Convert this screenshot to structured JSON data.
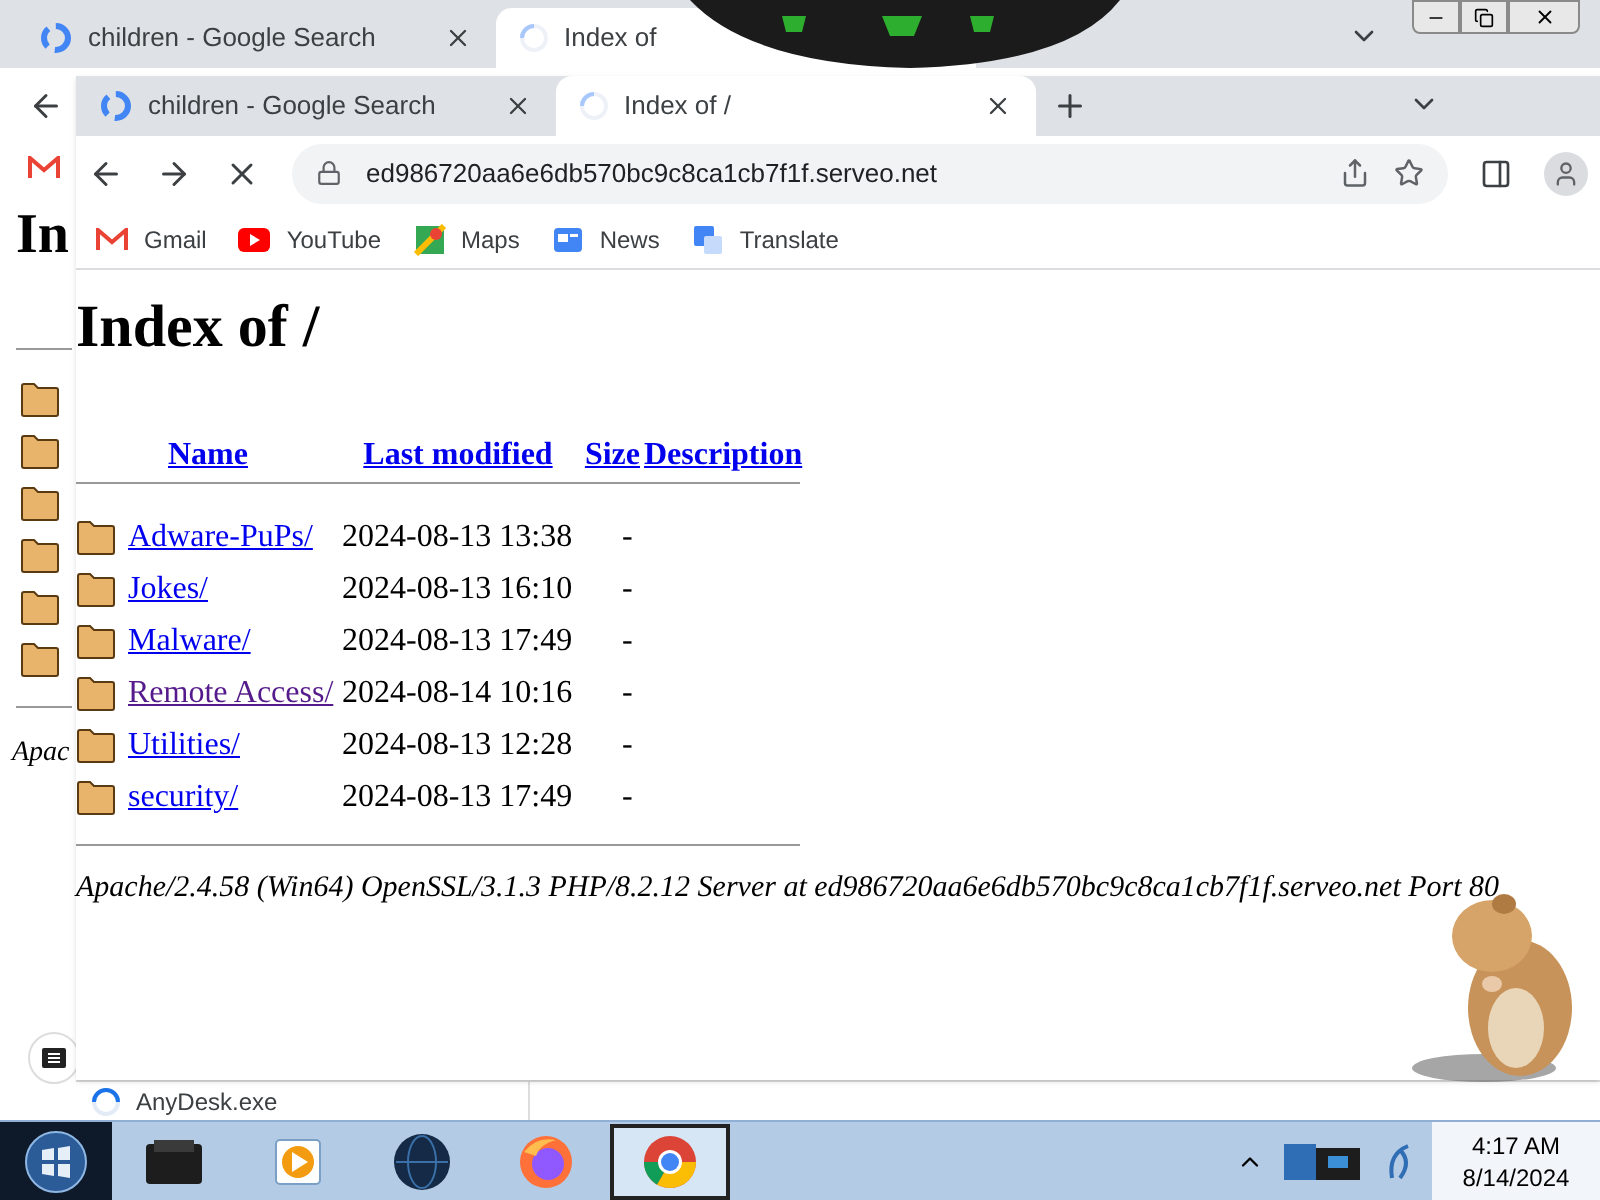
{
  "outer_browser": {
    "tabs": [
      {
        "title": "children - Google Search",
        "kind": "google",
        "selected": false
      },
      {
        "title": "Index of",
        "kind": "loading",
        "selected": true
      }
    ],
    "page_heading": "In",
    "footer": "Apac",
    "download": "AnyDesk.exe"
  },
  "inner_browser": {
    "tabs": [
      {
        "title": "children - Google Search",
        "kind": "google",
        "selected": false
      },
      {
        "title": "Index of /",
        "kind": "loading",
        "selected": true
      }
    ],
    "url": "ed986720aa6e6db570bc9c8ca1cb7f1f.serveo.net",
    "bookmarks": [
      {
        "label": "Gmail",
        "kind": "gmail"
      },
      {
        "label": "YouTube",
        "kind": "youtube"
      },
      {
        "label": "Maps",
        "kind": "maps"
      },
      {
        "label": "News",
        "kind": "news"
      },
      {
        "label": "Translate",
        "kind": "translate"
      }
    ]
  },
  "page": {
    "heading": "Index of /",
    "columns": [
      "Name",
      "Last modified",
      "Size",
      "Description"
    ],
    "rows": [
      {
        "name": "Adware-PuPs/",
        "modified": "2024-08-13 13:38",
        "size": "-",
        "visited": false
      },
      {
        "name": "Jokes/",
        "modified": "2024-08-13 16:10",
        "size": "-",
        "visited": false
      },
      {
        "name": "Malware/",
        "modified": "2024-08-13 17:49",
        "size": "-",
        "visited": false
      },
      {
        "name": "Remote Access/",
        "modified": "2024-08-14 10:16",
        "size": "-",
        "visited": true
      },
      {
        "name": "Utilities/",
        "modified": "2024-08-13 12:28",
        "size": "-",
        "visited": false
      },
      {
        "name": "security/",
        "modified": "2024-08-13 17:49",
        "size": "-",
        "visited": false
      }
    ],
    "address": "Apache/2.4.58 (Win64) OpenSSL/3.1.3 PHP/8.2.12 Server at ed986720aa6e6db570bc9c8ca1cb7f1f.serveo.net Port 80"
  },
  "taskbar": {
    "apps": [
      {
        "kind": "device",
        "selected": false
      },
      {
        "kind": "media",
        "selected": false
      },
      {
        "kind": "globe",
        "selected": false
      },
      {
        "kind": "firefox",
        "selected": false
      },
      {
        "kind": "chrome",
        "selected": true
      }
    ],
    "time": "4:17 AM",
    "date": "8/14/2024"
  }
}
